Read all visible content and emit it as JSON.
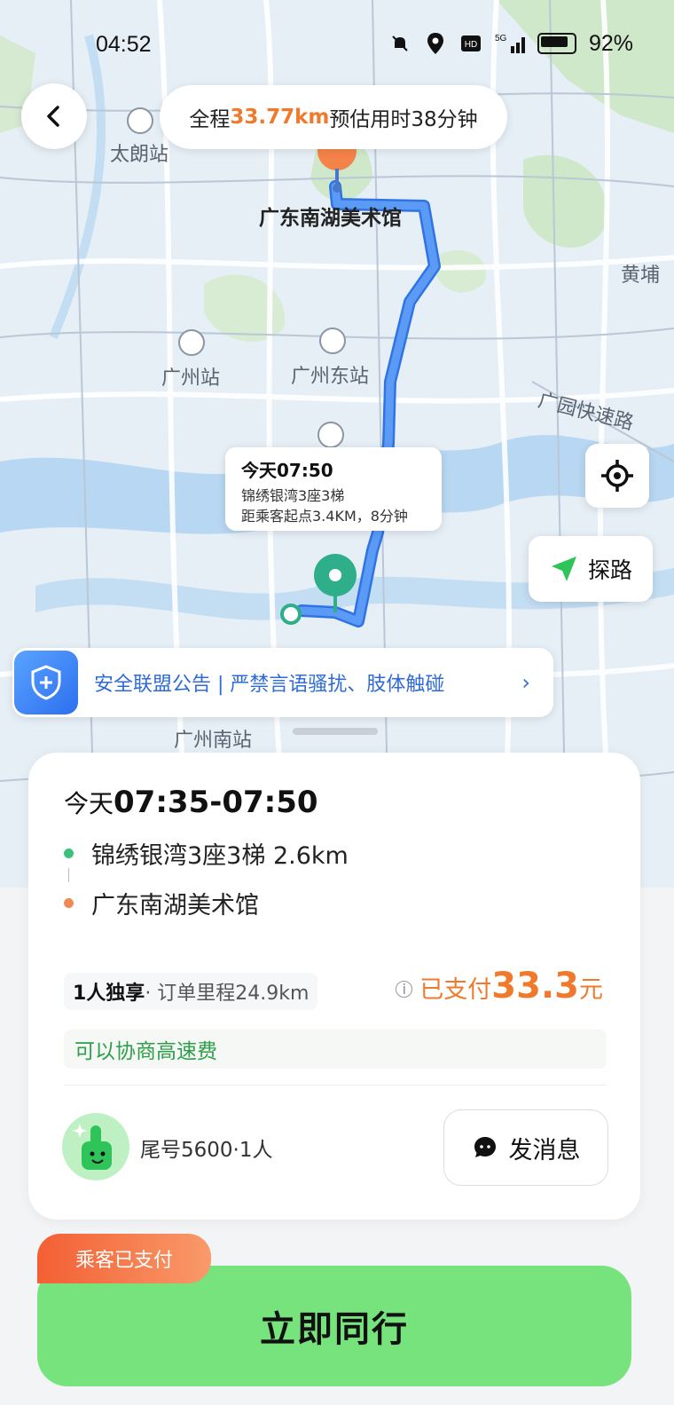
{
  "status_bar": {
    "time": "04:52",
    "network": "5G",
    "battery": "92%"
  },
  "trip": {
    "prefix": "全程",
    "distance": "33.77km",
    "estimate": " 预估用时38分钟"
  },
  "map": {
    "labels": [
      "太朗站",
      "广州站",
      "广州东站",
      "广园快速路",
      "黄埔",
      "广州南站"
    ],
    "destination": "广东南湖美术馆",
    "pickup_card": {
      "time": "今天07:50",
      "place": "锦绣银湾3座3梯",
      "detail": "距乘客起点3.4KM，8分钟"
    },
    "explore_label": "探路"
  },
  "safety_banner": {
    "text": "安全联盟公告 | 严禁言语骚扰、肢体触碰"
  },
  "order": {
    "time_prefix": "今天",
    "time_range": "07:35-07:50",
    "origin": "锦绣银湾3座3梯 2.6km",
    "destination": "广东南湖美术馆",
    "seat": "1人独享",
    "mileage": " · 订单里程24.9km",
    "paid_label": "已支付",
    "paid_amount": "33.3",
    "paid_unit": "元",
    "toll_note": "可以协商高速费",
    "passenger": "尾号5600·1人",
    "message_button": "发消息"
  },
  "action": {
    "tag": "乘客已支付",
    "button": "立即同行"
  },
  "colors": {
    "route": "#4a8ff0",
    "accent_orange": "#f0792c",
    "go_green": "#77e37c",
    "pin_green": "#2fae8a"
  }
}
